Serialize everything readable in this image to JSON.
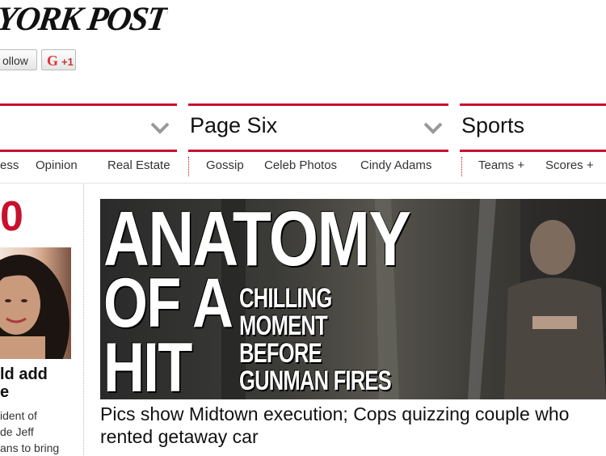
{
  "header": {
    "logo_text": "YORK POST",
    "follow_label": "ollow",
    "gplus_icon": "G",
    "gplus_label": "+1"
  },
  "sections": [
    {
      "title": ""
    },
    {
      "title": "Page Six"
    },
    {
      "title": "Sports"
    }
  ],
  "subnav": {
    "news": [
      "ess",
      "Opinion",
      "Real Estate"
    ],
    "pagesix": [
      "Gossip",
      "Celeb Photos",
      "Cindy Adams"
    ],
    "sports": [
      "Teams +",
      "Scores +"
    ]
  },
  "sidebar": {
    "big_number": "0",
    "headline_line1": "ld add",
    "headline_line2": "e",
    "body_line1": "ident of",
    "body_line2": "de Jeff",
    "body_line3": "ans to bring"
  },
  "hero": {
    "big_line1": "ANATOMY",
    "big_line2": "OF A",
    "big_line3": "HIT",
    "small_line1": "CHILLING",
    "small_line2": "MOMENT",
    "small_line3": "BEFORE",
    "small_line4": "GUNMAN FIRES",
    "caption": "Pics show Midtown execution; Cops quizzing couple who rented getaway car"
  },
  "colors": {
    "accent": "#c8102e"
  }
}
